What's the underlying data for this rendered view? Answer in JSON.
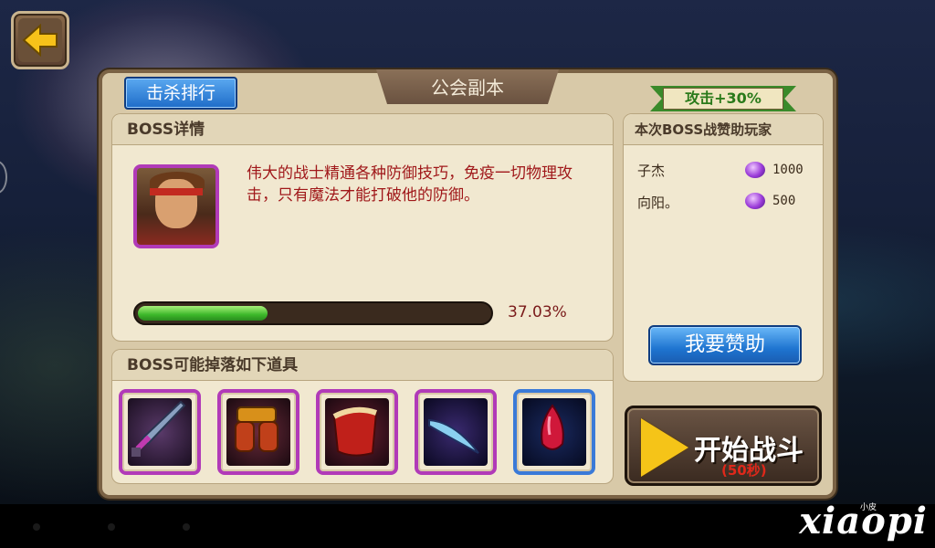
{
  "header": {
    "title": "公会副本",
    "rank_button": "击杀排行"
  },
  "boss_detail": {
    "heading": "BOSS详情",
    "description": "伟大的战士精通各种防御技巧，免疫一切物理攻击，只有魔法才能打破他的防御。",
    "progress_percent": 37.03,
    "progress_label": "37.03%"
  },
  "drops": {
    "heading": "BOSS可能掉落如下道具",
    "items": [
      {
        "name": "sword",
        "border": "#b13ab8"
      },
      {
        "name": "armor-belt",
        "border": "#b13ab8"
      },
      {
        "name": "cape",
        "border": "#b13ab8"
      },
      {
        "name": "blade",
        "border": "#b13ab8"
      },
      {
        "name": "red-gem",
        "border": "#3a7ad8"
      }
    ]
  },
  "sponsor": {
    "bonus": "攻击+30%",
    "heading": "本次BOSS战赞助玩家",
    "players": [
      {
        "name": "子杰",
        "amount": "1000"
      },
      {
        "name": "向阳。",
        "amount": "500"
      }
    ],
    "sponsor_button": "我要赞助"
  },
  "start": {
    "label": "开始战斗",
    "timer": "(50秒)"
  },
  "watermark": {
    "small": "小皮",
    "large": "xiaopi"
  }
}
